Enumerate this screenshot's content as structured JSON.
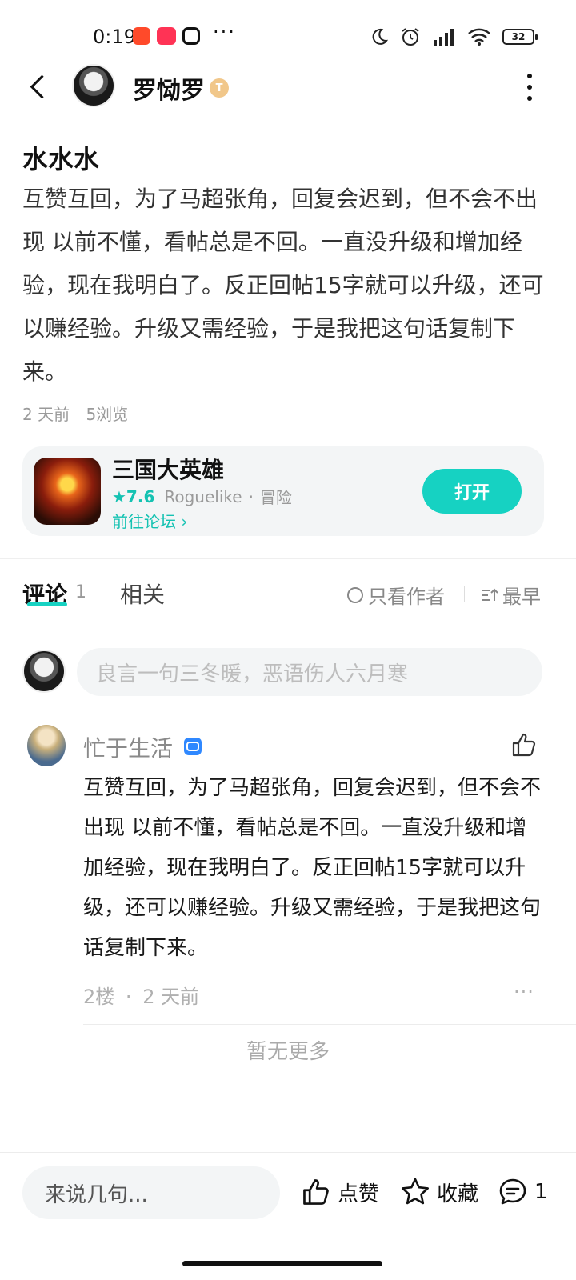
{
  "status_bar": {
    "time": "0:19",
    "battery": "32"
  },
  "header": {
    "author_name": "罗恸罗",
    "author_badge": "T"
  },
  "post": {
    "title": "水水水",
    "body": "互赞互回，为了马超张角，回复会迟到，但不会不出现 以前不懂，看帖总是不回。一直没升级和增加经验，现在我明白了。反正回帖15字就可以升级，还可以赚经验。升级又需经验，于是我把这句话复制下来。",
    "time_ago": "2 天前",
    "views": "5浏览"
  },
  "game_card": {
    "name": "三国大英雄",
    "rating": "★7.6",
    "genre1": "Roguelike",
    "separator": "·",
    "genre2": "冒险",
    "forum_link": "前往论坛 ›",
    "open_label": "打开",
    "accent_color": "#16d2c2"
  },
  "tabs": {
    "comments_label": "评论",
    "comments_count": "1",
    "related_label": "相关",
    "author_only_label": "只看作者",
    "sort_label": "最早"
  },
  "comment_input": {
    "placeholder": "良言一句三冬暖，恶语伤人六月寒"
  },
  "comments": [
    {
      "user": "忙于生活",
      "body": "互赞互回，为了马超张角，回复会迟到，但不会不出现 以前不懂，看帖总是不回。一直没升级和增加经验，现在我明白了。反正回帖15字就可以升级，还可以赚经验。升级又需经验，于是我把这句话复制下来。",
      "floor": "2楼",
      "dot": "·",
      "time_ago": "2 天前",
      "more": "···"
    }
  ],
  "no_more": "暂无更多",
  "bottom_bar": {
    "input_placeholder": "来说几句...",
    "like_label": "点赞",
    "fav_label": "收藏",
    "comment_count": "1"
  },
  "icons": [
    "back-icon",
    "more-vertical-icon",
    "thumbs-up-icon",
    "star-icon",
    "comment-icon",
    "sort-icon",
    "circle-icon",
    "wifi-icon",
    "signal-icon",
    "alarm-icon",
    "moon-icon"
  ]
}
